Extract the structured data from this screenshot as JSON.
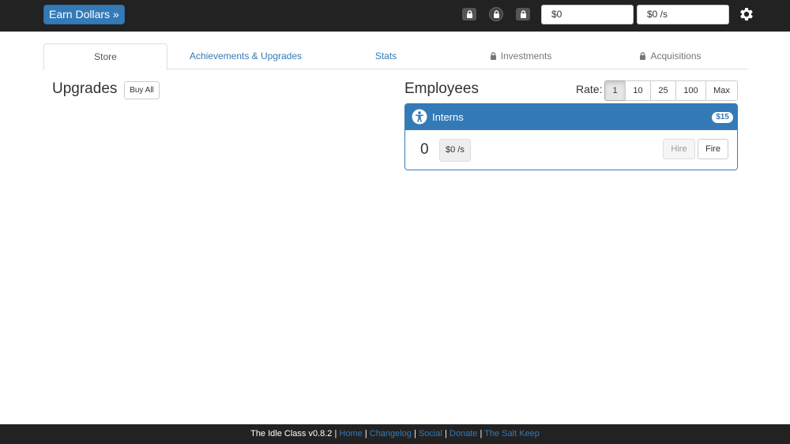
{
  "header": {
    "earn_button": "Earn Dollars »",
    "money": "$0",
    "income_rate": "$0 /s",
    "locked_icons": [
      "lock-icon",
      "lock-icon",
      "lock-icon"
    ],
    "settings_icon": "gear-icon"
  },
  "tabs": [
    {
      "label": "Store",
      "active": true,
      "locked": false
    },
    {
      "label": "Achievements & Upgrades",
      "active": false,
      "locked": false
    },
    {
      "label": "Stats",
      "active": false,
      "locked": false
    },
    {
      "label": "Investments",
      "active": false,
      "locked": true
    },
    {
      "label": "Acquisitions",
      "active": false,
      "locked": true
    }
  ],
  "upgrades": {
    "title": "Upgrades",
    "buy_all": "Buy All"
  },
  "employees": {
    "title": "Employees",
    "rate_label": "Rate:",
    "rate_options": [
      "1",
      "10",
      "25",
      "100",
      "Max"
    ],
    "rate_selected": "1",
    "items": [
      {
        "name": "Interns",
        "cost": "$15",
        "count": "0",
        "income": "$0 /s",
        "hire_label": "Hire",
        "fire_label": "Fire",
        "icon": "person-icon"
      }
    ]
  },
  "footer": {
    "text": "The Idle Class v0.8.2",
    "links": [
      "Home",
      "Changelog",
      "Social",
      "Donate",
      "The Salt Keep"
    ]
  },
  "colors": {
    "navbar": "#222222",
    "primary": "#337ab7"
  }
}
